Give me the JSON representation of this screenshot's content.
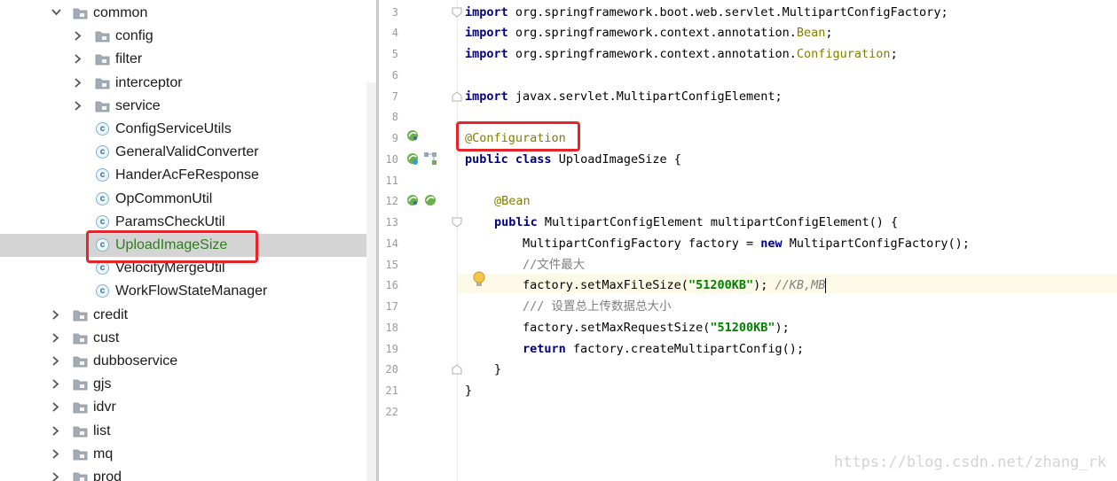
{
  "tree": {
    "items": [
      {
        "label": "common",
        "type": "folder",
        "expanded": true
      },
      {
        "label": "config",
        "type": "folder",
        "expanded": false
      },
      {
        "label": "filter",
        "type": "folder",
        "expanded": false
      },
      {
        "label": "interceptor",
        "type": "folder",
        "expanded": false
      },
      {
        "label": "service",
        "type": "folder",
        "expanded": false
      },
      {
        "label": "ConfigServiceUtils",
        "type": "class"
      },
      {
        "label": "GeneralValidConverter",
        "type": "class"
      },
      {
        "label": "HanderAcFeResponse",
        "type": "class"
      },
      {
        "label": "OpCommonUtil",
        "type": "class"
      },
      {
        "label": "ParamsCheckUtil",
        "type": "class"
      },
      {
        "label": "UploadImageSize",
        "type": "class",
        "selected": true
      },
      {
        "label": "VelocityMergeUtil",
        "type": "class"
      },
      {
        "label": "WorkFlowStateManager",
        "type": "class"
      },
      {
        "label": "credit",
        "type": "folder",
        "expanded": false
      },
      {
        "label": "cust",
        "type": "folder",
        "expanded": false
      },
      {
        "label": "dubboservice",
        "type": "folder",
        "expanded": false
      },
      {
        "label": "gjs",
        "type": "folder",
        "expanded": false
      },
      {
        "label": "idvr",
        "type": "folder",
        "expanded": false
      },
      {
        "label": "list",
        "type": "folder",
        "expanded": false
      },
      {
        "label": "mq",
        "type": "folder",
        "expanded": false
      },
      {
        "label": "prod",
        "type": "folder",
        "expanded": false
      }
    ],
    "class_icon_letter": "c"
  },
  "editor": {
    "line_numbers": [
      "3",
      "4",
      "5",
      "6",
      "7",
      "8",
      "9",
      "10",
      "11",
      "12",
      "13",
      "14",
      "15",
      "16",
      "17",
      "18",
      "19",
      "20",
      "21",
      "22"
    ],
    "l3": {
      "kw": "import",
      "rest": " org.springframework.boot.web.servlet.MultipartConfigFactory;"
    },
    "l4": {
      "kw": "import",
      "rest": " org.springframework.context.annotation.",
      "cls": "Bean",
      "end": ";"
    },
    "l5": {
      "kw": "import",
      "rest": " org.springframework.context.annotation.",
      "cls": "Configuration",
      "end": ";"
    },
    "l7": {
      "kw": "import",
      "rest": " javax.servlet.MultipartConfigElement;"
    },
    "l9": {
      "ann": "@Configuration"
    },
    "l10": {
      "kw1": "public",
      "kw2": "class",
      "rest": " UploadImageSize {"
    },
    "l12": {
      "ann": "@Bean"
    },
    "l13": {
      "kw": "public",
      "rest": " MultipartConfigElement multipartConfigElement() {"
    },
    "l14": {
      "a": "MultipartConfigFactory factory = ",
      "kw": "new",
      "b": " MultipartConfigFactory();"
    },
    "l15": {
      "cmt": "//文件最大"
    },
    "l16": {
      "a": "factory.setMaxFileSize(",
      "str": "\"51200KB\"",
      "b": "); ",
      "cmt": "//KB,MB"
    },
    "l17": {
      "cmt": "/// 设置总上传数据总大小"
    },
    "l18": {
      "a": "factory.setMaxRequestSize(",
      "str": "\"51200KB\"",
      "b": ");"
    },
    "l19": {
      "kw": "return",
      "rest": " factory.createMultipartConfig();"
    },
    "l20": {
      "text": "}"
    },
    "l21": {
      "text": "}"
    }
  },
  "watermark": "https://blog.csdn.net/zhang_rk",
  "colors": {
    "highlight_box": "#e8232a",
    "selected_row": "#d4d4d4",
    "current_line": "#fcfae6"
  }
}
